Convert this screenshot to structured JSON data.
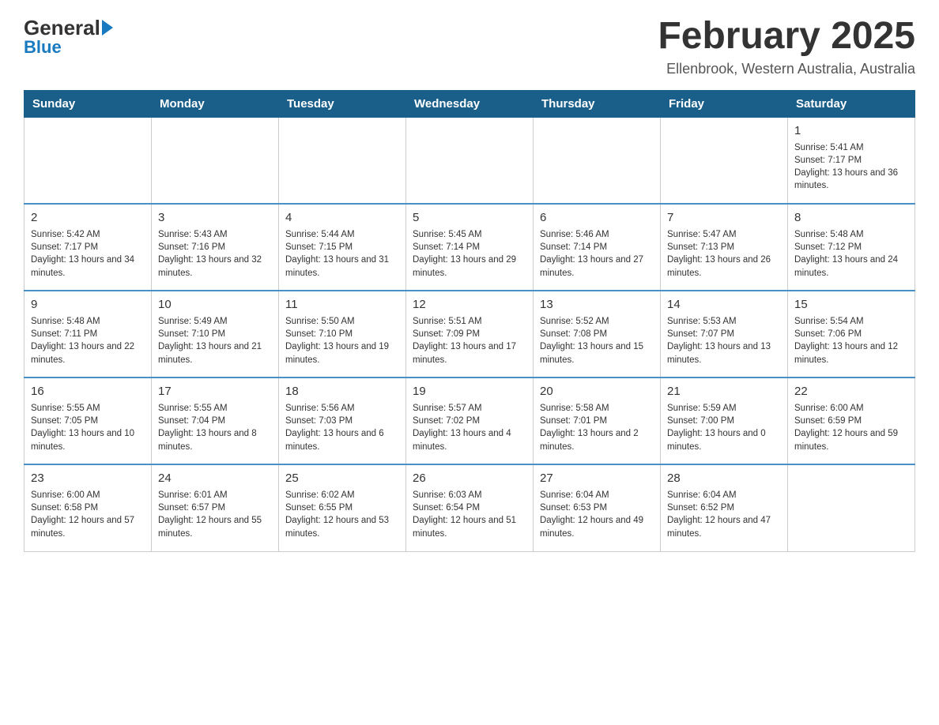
{
  "logo": {
    "text_general": "General",
    "text_blue": "Blue"
  },
  "header": {
    "title": "February 2025",
    "location": "Ellenbrook, Western Australia, Australia"
  },
  "days_of_week": [
    "Sunday",
    "Monday",
    "Tuesday",
    "Wednesday",
    "Thursday",
    "Friday",
    "Saturday"
  ],
  "weeks": [
    [
      {
        "day": "",
        "info": ""
      },
      {
        "day": "",
        "info": ""
      },
      {
        "day": "",
        "info": ""
      },
      {
        "day": "",
        "info": ""
      },
      {
        "day": "",
        "info": ""
      },
      {
        "day": "",
        "info": ""
      },
      {
        "day": "1",
        "info": "Sunrise: 5:41 AM\nSunset: 7:17 PM\nDaylight: 13 hours and 36 minutes."
      }
    ],
    [
      {
        "day": "2",
        "info": "Sunrise: 5:42 AM\nSunset: 7:17 PM\nDaylight: 13 hours and 34 minutes."
      },
      {
        "day": "3",
        "info": "Sunrise: 5:43 AM\nSunset: 7:16 PM\nDaylight: 13 hours and 32 minutes."
      },
      {
        "day": "4",
        "info": "Sunrise: 5:44 AM\nSunset: 7:15 PM\nDaylight: 13 hours and 31 minutes."
      },
      {
        "day": "5",
        "info": "Sunrise: 5:45 AM\nSunset: 7:14 PM\nDaylight: 13 hours and 29 minutes."
      },
      {
        "day": "6",
        "info": "Sunrise: 5:46 AM\nSunset: 7:14 PM\nDaylight: 13 hours and 27 minutes."
      },
      {
        "day": "7",
        "info": "Sunrise: 5:47 AM\nSunset: 7:13 PM\nDaylight: 13 hours and 26 minutes."
      },
      {
        "day": "8",
        "info": "Sunrise: 5:48 AM\nSunset: 7:12 PM\nDaylight: 13 hours and 24 minutes."
      }
    ],
    [
      {
        "day": "9",
        "info": "Sunrise: 5:48 AM\nSunset: 7:11 PM\nDaylight: 13 hours and 22 minutes."
      },
      {
        "day": "10",
        "info": "Sunrise: 5:49 AM\nSunset: 7:10 PM\nDaylight: 13 hours and 21 minutes."
      },
      {
        "day": "11",
        "info": "Sunrise: 5:50 AM\nSunset: 7:10 PM\nDaylight: 13 hours and 19 minutes."
      },
      {
        "day": "12",
        "info": "Sunrise: 5:51 AM\nSunset: 7:09 PM\nDaylight: 13 hours and 17 minutes."
      },
      {
        "day": "13",
        "info": "Sunrise: 5:52 AM\nSunset: 7:08 PM\nDaylight: 13 hours and 15 minutes."
      },
      {
        "day": "14",
        "info": "Sunrise: 5:53 AM\nSunset: 7:07 PM\nDaylight: 13 hours and 13 minutes."
      },
      {
        "day": "15",
        "info": "Sunrise: 5:54 AM\nSunset: 7:06 PM\nDaylight: 13 hours and 12 minutes."
      }
    ],
    [
      {
        "day": "16",
        "info": "Sunrise: 5:55 AM\nSunset: 7:05 PM\nDaylight: 13 hours and 10 minutes."
      },
      {
        "day": "17",
        "info": "Sunrise: 5:55 AM\nSunset: 7:04 PM\nDaylight: 13 hours and 8 minutes."
      },
      {
        "day": "18",
        "info": "Sunrise: 5:56 AM\nSunset: 7:03 PM\nDaylight: 13 hours and 6 minutes."
      },
      {
        "day": "19",
        "info": "Sunrise: 5:57 AM\nSunset: 7:02 PM\nDaylight: 13 hours and 4 minutes."
      },
      {
        "day": "20",
        "info": "Sunrise: 5:58 AM\nSunset: 7:01 PM\nDaylight: 13 hours and 2 minutes."
      },
      {
        "day": "21",
        "info": "Sunrise: 5:59 AM\nSunset: 7:00 PM\nDaylight: 13 hours and 0 minutes."
      },
      {
        "day": "22",
        "info": "Sunrise: 6:00 AM\nSunset: 6:59 PM\nDaylight: 12 hours and 59 minutes."
      }
    ],
    [
      {
        "day": "23",
        "info": "Sunrise: 6:00 AM\nSunset: 6:58 PM\nDaylight: 12 hours and 57 minutes."
      },
      {
        "day": "24",
        "info": "Sunrise: 6:01 AM\nSunset: 6:57 PM\nDaylight: 12 hours and 55 minutes."
      },
      {
        "day": "25",
        "info": "Sunrise: 6:02 AM\nSunset: 6:55 PM\nDaylight: 12 hours and 53 minutes."
      },
      {
        "day": "26",
        "info": "Sunrise: 6:03 AM\nSunset: 6:54 PM\nDaylight: 12 hours and 51 minutes."
      },
      {
        "day": "27",
        "info": "Sunrise: 6:04 AM\nSunset: 6:53 PM\nDaylight: 12 hours and 49 minutes."
      },
      {
        "day": "28",
        "info": "Sunrise: 6:04 AM\nSunset: 6:52 PM\nDaylight: 12 hours and 47 minutes."
      },
      {
        "day": "",
        "info": ""
      }
    ]
  ]
}
